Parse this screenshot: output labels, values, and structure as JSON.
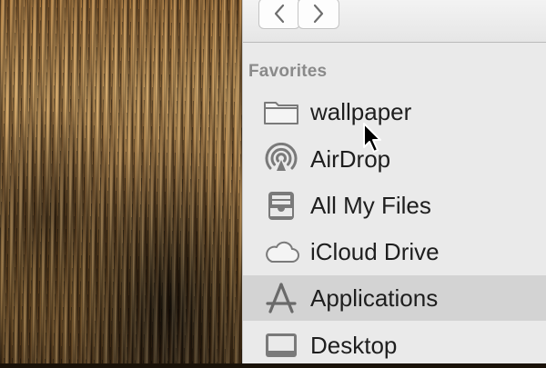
{
  "toolbar": {
    "back_icon": "chevron-left-icon",
    "forward_icon": "chevron-right-icon"
  },
  "sidebar": {
    "section_title": "Favorites",
    "items": [
      {
        "label": "wallpaper",
        "icon": "folder-icon",
        "selected": false
      },
      {
        "label": "AirDrop",
        "icon": "airdrop-icon",
        "selected": false
      },
      {
        "label": "All My Files",
        "icon": "all-my-files-icon",
        "selected": false
      },
      {
        "label": "iCloud Drive",
        "icon": "cloud-icon",
        "selected": false
      },
      {
        "label": "Applications",
        "icon": "applications-icon",
        "selected": true
      },
      {
        "label": "Desktop",
        "icon": "desktop-icon",
        "selected": false
      }
    ]
  },
  "colors": {
    "sidebar_bg": "#eaeaea",
    "selected_bg": "#d3d3d3",
    "icon_gray": "#7a7a7a",
    "section_title": "#8a8a8a"
  }
}
